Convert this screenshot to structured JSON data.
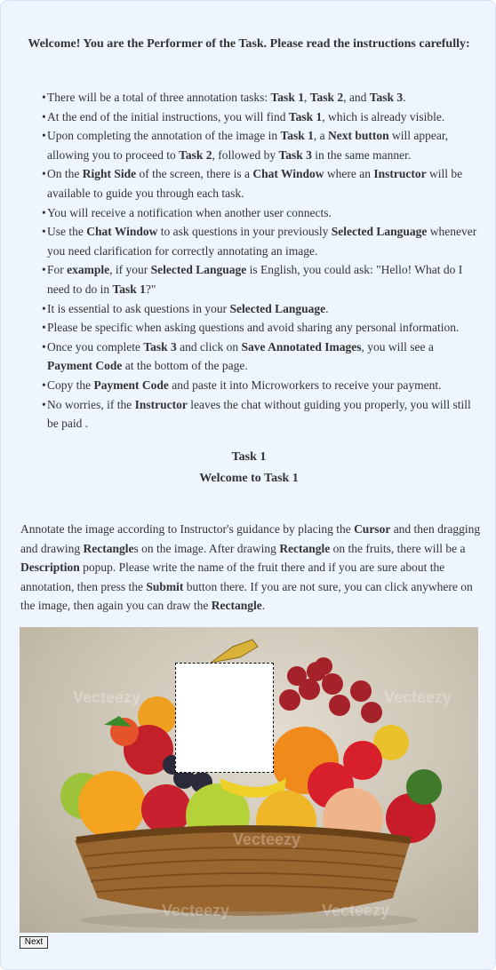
{
  "welcome": "Welcome! You are the Performer of the Task. Please read the instructions carefully:",
  "instructions": [
    [
      {
        "t": "There will be a total of three annotation tasks: "
      },
      {
        "t": "Task 1",
        "b": true
      },
      {
        "t": ", "
      },
      {
        "t": "Task 2",
        "b": true
      },
      {
        "t": ", and "
      },
      {
        "t": "Task 3",
        "b": true
      },
      {
        "t": "."
      }
    ],
    [
      {
        "t": "At the end of the initial instructions, you will find "
      },
      {
        "t": "Task 1",
        "b": true
      },
      {
        "t": ", which is already visible."
      }
    ],
    [
      {
        "t": "Upon completing the annotation of the image in "
      },
      {
        "t": "Task 1",
        "b": true
      },
      {
        "t": ", a "
      },
      {
        "t": "Next button",
        "b": true
      },
      {
        "t": " will appear, allowing you to proceed to "
      },
      {
        "t": "Task 2",
        "b": true
      },
      {
        "t": ", followed by "
      },
      {
        "t": "Task 3",
        "b": true
      },
      {
        "t": " in the same manner."
      }
    ],
    [
      {
        "t": "On the "
      },
      {
        "t": "Right Side",
        "b": true
      },
      {
        "t": " of the screen, there is a "
      },
      {
        "t": "Chat Window",
        "b": true
      },
      {
        "t": " where an "
      },
      {
        "t": "Instructor",
        "b": true
      },
      {
        "t": " will be available to guide you through each task."
      }
    ],
    [
      {
        "t": "You will receive a notification when another user connects."
      }
    ],
    [
      {
        "t": "Use the "
      },
      {
        "t": "Chat Window",
        "b": true
      },
      {
        "t": " to ask questions in your previously "
      },
      {
        "t": "Selected Language",
        "b": true
      },
      {
        "t": " whenever you need clarification for correctly annotating an image."
      }
    ],
    [
      {
        "t": "For "
      },
      {
        "t": "example",
        "b": true
      },
      {
        "t": ", if your "
      },
      {
        "t": "Selected Language",
        "b": true
      },
      {
        "t": " is English, you could ask: \"Hello! What do I need to do in "
      },
      {
        "t": "Task 1",
        "b": true
      },
      {
        "t": "?\""
      }
    ],
    [
      {
        "t": "It is essential to ask questions in your "
      },
      {
        "t": "Selected Language",
        "b": true
      },
      {
        "t": "."
      }
    ],
    [
      {
        "t": "Please be specific when asking questions and avoid sharing any personal information."
      }
    ],
    [
      {
        "t": "Once you complete "
      },
      {
        "t": "Task 3",
        "b": true
      },
      {
        "t": " and click on "
      },
      {
        "t": "Save Annotated Images",
        "b": true
      },
      {
        "t": ", you will see a "
      },
      {
        "t": "Payment Code",
        "b": true
      },
      {
        "t": " at the bottom of the page."
      }
    ],
    [
      {
        "t": "Copy the "
      },
      {
        "t": "Payment Code",
        "b": true
      },
      {
        "t": " and paste it into Microworkers to receive your payment."
      }
    ],
    [
      {
        "t": "No worries, if the "
      },
      {
        "t": "Instructor",
        "b": true
      },
      {
        "t": " leaves the chat without guiding you properly, you will still be paid ."
      }
    ]
  ],
  "task": {
    "number": "Task 1",
    "title": "Welcome to Task 1",
    "description": [
      {
        "t": "Annotate the image according to Instructor's guidance by placing the "
      },
      {
        "t": "Cursor",
        "b": true
      },
      {
        "t": " and then dragging and drawing "
      },
      {
        "t": "Rectangle",
        "b": true
      },
      {
        "t": "s on the image. After drawing "
      },
      {
        "t": "Rectangle",
        "b": true
      },
      {
        "t": " on the fruits, there will be a "
      },
      {
        "t": "Description",
        "b": true
      },
      {
        "t": " popup. Please write the name of the fruit there and if you are sure about the annotation, then press the "
      },
      {
        "t": "Submit",
        "b": true
      },
      {
        "t": " button there. If you are not sure, you can click anywhere on the image, then again you can draw the "
      },
      {
        "t": "Rectangle",
        "b": true
      },
      {
        "t": "."
      }
    ]
  },
  "image": {
    "watermark": "Vecteezy"
  },
  "next_label": "Next"
}
